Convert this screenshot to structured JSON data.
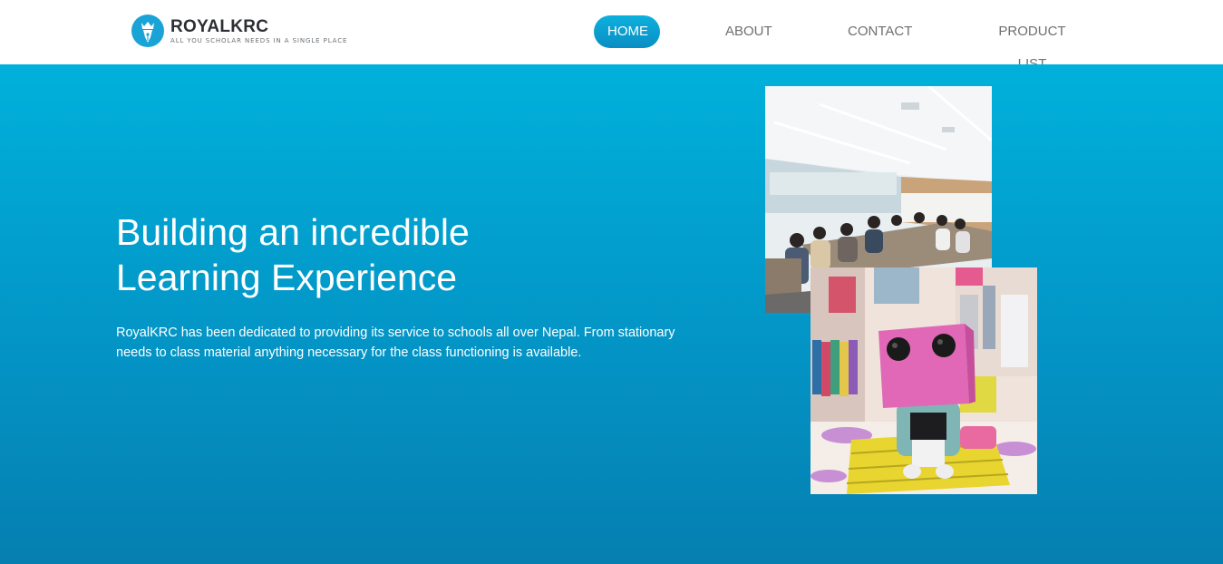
{
  "header": {
    "brand_name": "ROYALKRC",
    "tagline": "ALL YOU SCHOLAR NEEDS IN A SINGLE PLACE",
    "logo_icon": "pen-nib-crown-icon"
  },
  "nav": {
    "items": [
      {
        "label": "HOME",
        "active": true
      },
      {
        "label": "ABOUT",
        "active": false
      },
      {
        "label": "CONTACT",
        "active": false
      },
      {
        "label": "PRODUCT LIST",
        "active": false
      }
    ]
  },
  "hero": {
    "title_line1": "Building an incredible",
    "title_line2": "Learning Experience",
    "description": "RoyalKRC has been dedicated to providing its service to schools all over Nepal. From stationary needs to class material anything necessary for the class functioning is available.",
    "images": [
      {
        "subject": "classroom-photo"
      },
      {
        "subject": "kids-store-photo"
      }
    ]
  },
  "colors": {
    "accent": "#0a9fd2",
    "hero_top": "#00b1db",
    "hero_bottom": "#057fb0",
    "nav_text": "#6d6f72"
  }
}
